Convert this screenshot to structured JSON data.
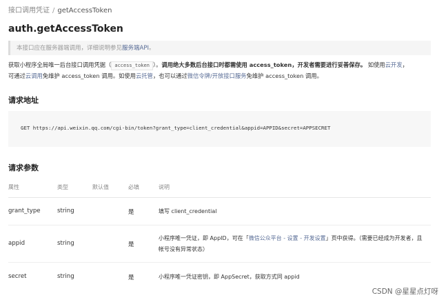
{
  "breadcrumb": {
    "parent": "接口调用凭证",
    "separator": "/",
    "current": "getAccessToken"
  },
  "title": "auth.getAccessToken",
  "note": {
    "text": "本接口应在服务器端调用，详细说明参见",
    "link": "服务端API",
    "end": "。"
  },
  "description": {
    "l1_a": "获取小程序全局唯一后台接口调用凭据（",
    "l1_code": "access_token",
    "l1_b": "）。",
    "l1_bold": "调用绝大多数后台接口时都需使用 access_token，开发者需要进行妥善保存。",
    "l1_c": " 如使用",
    "l1_link": "云开发",
    "l1_d": "，",
    "l2_a": "可通过",
    "l2_link1": "云调用",
    "l2_b": "免维护 access_token 调用。如使用",
    "l2_link2": "云托管",
    "l2_c": "，也可以通过",
    "l2_link3": "微信令牌/开放接口服务",
    "l2_d": "免维护 access_token 调用。"
  },
  "request_section": {
    "title": "请求地址"
  },
  "request_url": "GET https://api.weixin.qq.com/cgi-bin/token?grant_type=client_credential&appid=APPID&secret=APPSECRET",
  "params_section": {
    "title": "请求参数"
  },
  "table": {
    "headers": {
      "name": "属性",
      "type": "类型",
      "default": "默认值",
      "required": "必填",
      "desc": "说明"
    },
    "rows": [
      {
        "name": "grant_type",
        "type": "string",
        "required": "是",
        "desc": "填写 client_credential"
      },
      {
        "name": "appid",
        "type": "string",
        "required": "是",
        "desc_a": "小程序唯一凭证，即 AppID，可在「",
        "desc_link": "微信公众平台 - 设置 - 开发设置",
        "desc_b": "」页中获得。（需要已经成为开发者，且帐号没有异常状态）"
      },
      {
        "name": "secret",
        "type": "string",
        "required": "是",
        "desc": "小程序唯一凭证密钥，即 AppSecret，获取方式同 appid"
      }
    ]
  },
  "watermark": "CSDN @星星点灯呀"
}
